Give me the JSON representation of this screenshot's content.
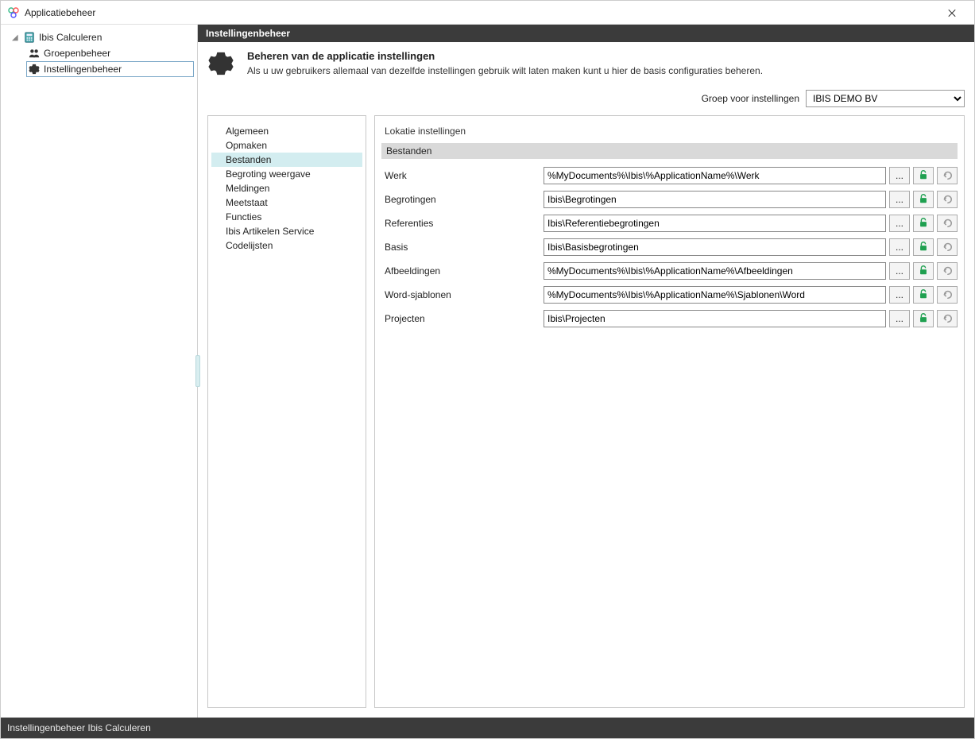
{
  "window": {
    "title": "Applicatiebeheer"
  },
  "sidebar": {
    "root": {
      "label": "Ibis Calculeren",
      "children": [
        {
          "label": "Groepenbeheer",
          "icon": "users"
        },
        {
          "label": "Instellingenbeheer",
          "icon": "gear",
          "selected": true
        }
      ]
    }
  },
  "header": {
    "title": "Instellingenbeheer"
  },
  "intro": {
    "title": "Beheren van de applicatie instellingen",
    "description": "Als u uw gebruikers allemaal van dezelfde instellingen gebruik wilt laten maken kunt u hier de basis configuraties beheren."
  },
  "group_selector": {
    "label": "Groep voor instellingen",
    "selected": "IBIS DEMO BV"
  },
  "tabs": [
    {
      "label": "Algemeen"
    },
    {
      "label": "Opmaken"
    },
    {
      "label": "Bestanden",
      "selected": true
    },
    {
      "label": "Begroting weergave"
    },
    {
      "label": "Meldingen"
    },
    {
      "label": "Meetstaat"
    },
    {
      "label": "Functies"
    },
    {
      "label": "Ibis Artikelen Service"
    },
    {
      "label": "Codelijsten"
    }
  ],
  "panel": {
    "section_title": "Lokatie instellingen",
    "subsection": "Bestanden",
    "browse_label": "...",
    "fields": [
      {
        "label": "Werk",
        "value": "%MyDocuments%\\Ibis\\%ApplicationName%\\Werk"
      },
      {
        "label": "Begrotingen",
        "value": "Ibis\\Begrotingen"
      },
      {
        "label": "Referenties",
        "value": "Ibis\\Referentiebegrotingen"
      },
      {
        "label": "Basis",
        "value": "Ibis\\Basisbegrotingen"
      },
      {
        "label": "Afbeeldingen",
        "value": "%MyDocuments%\\Ibis\\%ApplicationName%\\Afbeeldingen"
      },
      {
        "label": "Word-sjablonen",
        "value": "%MyDocuments%\\Ibis\\%ApplicationName%\\Sjablonen\\Word"
      },
      {
        "label": "Projecten",
        "value": "Ibis\\Projecten"
      }
    ]
  },
  "statusbar": {
    "text": "Instellingenbeheer Ibis Calculeren"
  }
}
